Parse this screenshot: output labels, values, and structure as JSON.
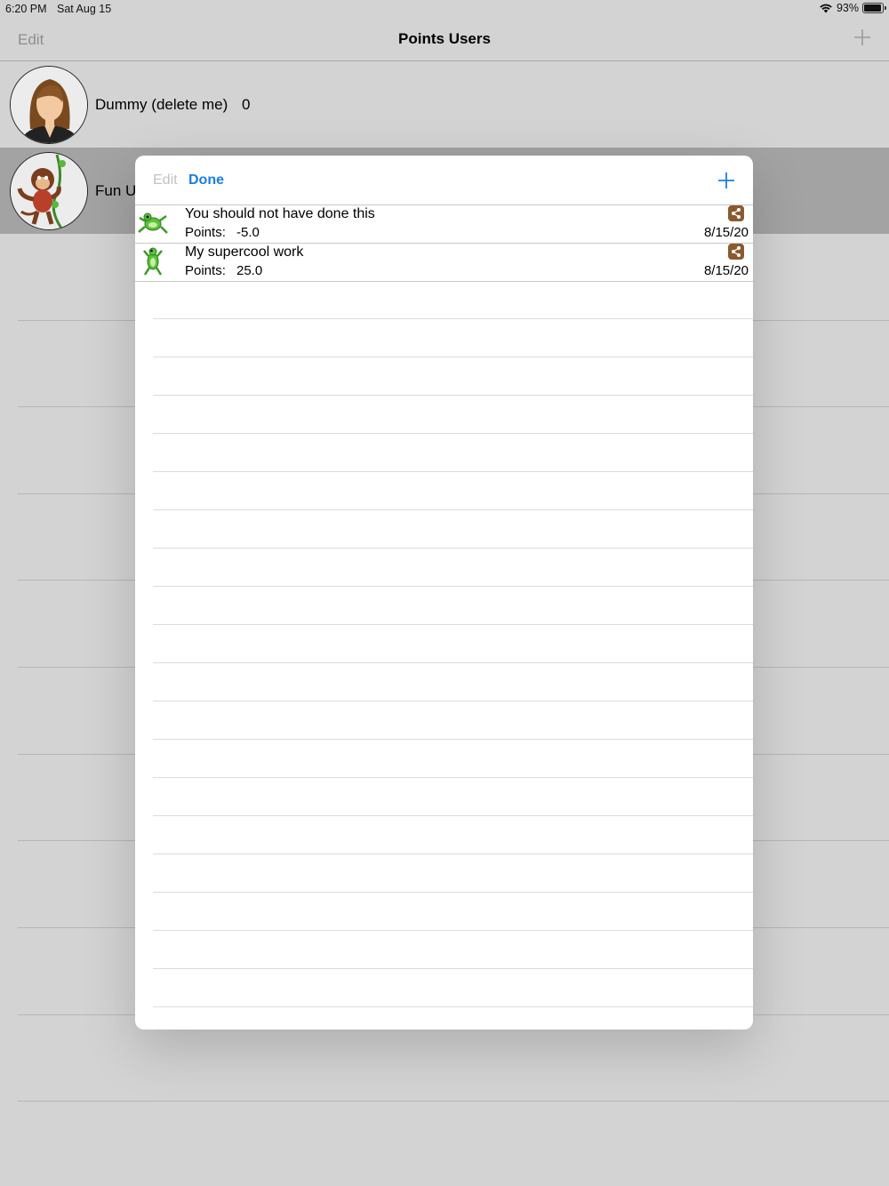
{
  "status_bar": {
    "time": "6:20 PM",
    "date": "Sat Aug 15",
    "battery": "93%",
    "battery_level": 0.93
  },
  "nav": {
    "edit_label": "Edit",
    "title": "Points Users",
    "add_icon": "plus-icon"
  },
  "users": [
    {
      "name": "Dummy (delete me)",
      "points": "0",
      "avatar": "woman-avatar"
    },
    {
      "name": "Fun Us",
      "points": "",
      "avatar": "monkey-avatar"
    }
  ],
  "modal": {
    "edit_label": "Edit",
    "done_label": "Done",
    "add_icon": "plus-icon",
    "entries": [
      {
        "title": "You should not have done this",
        "points_label": "Points:",
        "points": "-5.0",
        "date": "8/15/20",
        "icon": "frog-icon"
      },
      {
        "title": "My supercool work",
        "points_label": "Points:",
        "points": "25.0",
        "date": "8/15/20",
        "icon": "frog-icon"
      }
    ]
  },
  "colors": {
    "accent": "#1a7fe0",
    "share_badge": "#8a5a2e",
    "background": "#d3d3d3"
  }
}
